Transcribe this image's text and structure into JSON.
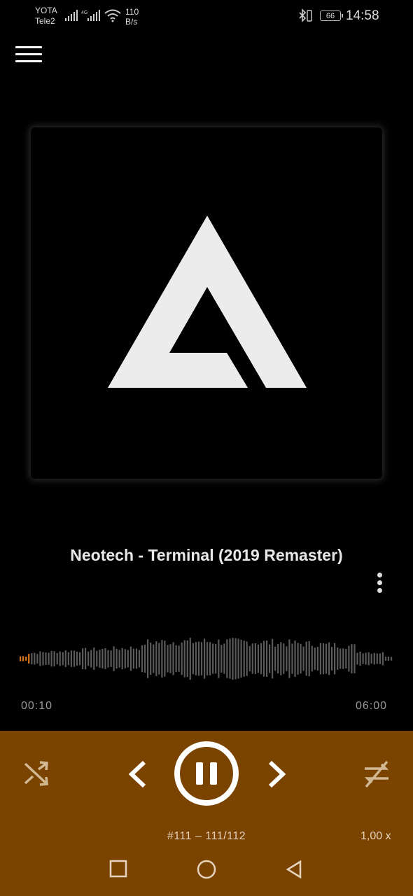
{
  "status": {
    "carrier1": "YOTA",
    "carrier2": "Tele2",
    "net_speed_value": "110",
    "net_speed_unit": "B/s",
    "battery": "66",
    "time": "14:58"
  },
  "player": {
    "title": "Neotech - Terminal (2019 Remaster)",
    "elapsed": "00:10",
    "duration": "06:00",
    "progress": 0.028,
    "track_info": "#111  –  111/112",
    "speed": "1,00 x",
    "accent": "#7a4400",
    "played_color": "#d9781c"
  },
  "icons": {
    "menu": "hamburger-menu-icon",
    "more": "more-vertical-icon",
    "shuffle": "shuffle-icon",
    "prev": "chevron-left-icon",
    "pause": "pause-icon",
    "next": "chevron-right-icon",
    "repeat": "repeat-off-icon"
  }
}
